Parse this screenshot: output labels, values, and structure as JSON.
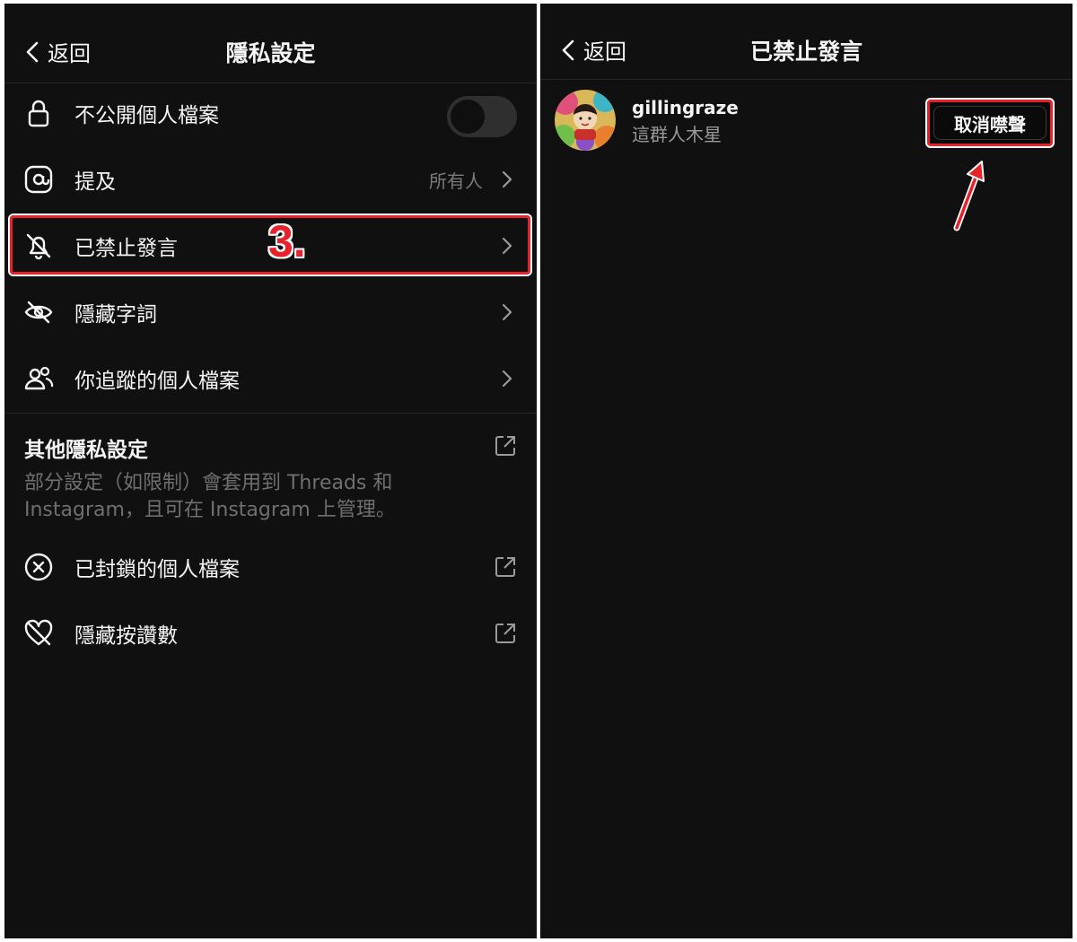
{
  "left": {
    "back_label": "返回",
    "title": "隱私設定",
    "rows": [
      {
        "label": "不公開個人檔案",
        "icon": "lock-icon"
      },
      {
        "label": "提及",
        "value": "所有人",
        "icon": "at-sign-icon"
      },
      {
        "label": "已禁止發言",
        "icon": "bell-off-icon"
      },
      {
        "label": "隱藏字詞",
        "icon": "eye-off-icon"
      },
      {
        "label": "你追蹤的個人檔案",
        "icon": "people-icon"
      }
    ],
    "other_section": {
      "title": "其他隱私設定",
      "description": "部分設定（如限制）會套用到 Threads 和 Instagram，且可在 Instagram 上管理。"
    },
    "other_rows": [
      {
        "label": "已封鎖的個人檔案",
        "icon": "block-circle-icon"
      },
      {
        "label": "隱藏按讚數",
        "icon": "heart-off-icon"
      }
    ],
    "private_profile_toggle": "off",
    "annotation_step": "3."
  },
  "right": {
    "back_label": "返回",
    "title": "已禁止發言",
    "muted_user": {
      "username": "gillingraze",
      "display_name": "這群人木星",
      "action_label": "取消噤聲"
    }
  },
  "colors": {
    "background": "#101010",
    "annotation_red": "#e8222a",
    "secondary_text": "#7a7a7a"
  }
}
